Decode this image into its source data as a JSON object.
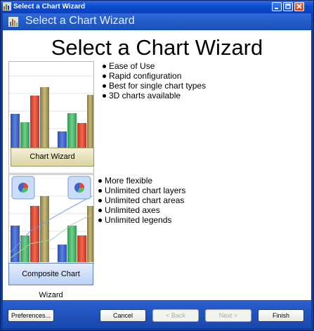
{
  "window": {
    "title": "Select a Chart Wizard",
    "header": "Select a Chart Wizard"
  },
  "main": {
    "heading": "Select a Chart Wizard",
    "chart_wizard": {
      "features": [
        "Ease of Use",
        "Rapid configuration",
        "Best for single chart types",
        "3D charts available"
      ],
      "button_label": "Chart Wizard"
    },
    "composite_wizard": {
      "features": [
        "More flexible",
        "Unlimited chart layers",
        "Unlimited chart areas",
        "Unlimited axes",
        "Unlimited legends"
      ],
      "button_label": "Composite Chart Wizard"
    }
  },
  "footer": {
    "preferences": "Preferences...",
    "cancel": "Cancel",
    "back": "< Back",
    "next": "Next >",
    "finish": "Finish"
  },
  "colors": {
    "bar_blue": "#3f63c7",
    "bar_green": "#55b86b",
    "bar_red": "#e2452f",
    "bar_olive": "#a89a5a",
    "chart_wizard_button": "#ece6bd",
    "composite_button": "#cfe0fb"
  }
}
